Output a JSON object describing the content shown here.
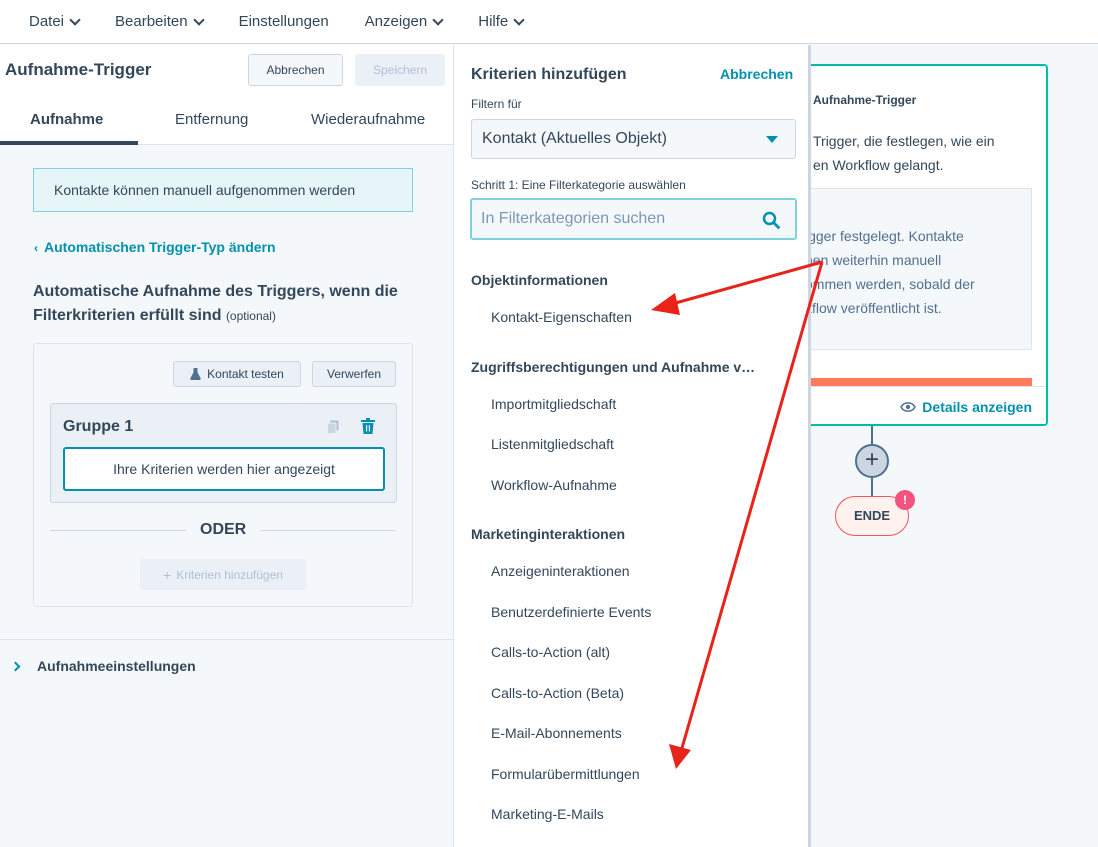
{
  "menu": [
    "Datei",
    "Bearbeiten",
    "Einstellungen",
    "Anzeigen",
    "Hilfe"
  ],
  "left_panel": {
    "title": "Aufnahme-Trigger",
    "cancel_label": "Abbrechen",
    "save_label": "Speichern",
    "tabs": [
      "Aufnahme",
      "Entfernung",
      "Wiederaufnahme"
    ],
    "active_tab": "Aufnahme",
    "info_text": "Kontakte können manuell aufgenommen werden",
    "change_link": "Automatischen Trigger-Typ ändern",
    "section_title": "Automatische Aufnahme des Triggers, wenn die Filterkriterien erfüllt sind",
    "section_optional": "(optional)",
    "test_contact_label": "Kontakt testen",
    "discard_label": "Verwerfen",
    "group_title": "Gruppe 1",
    "criteria_placeholder": "Ihre Kriterien werden hier angezeigt",
    "or_label": "ODER",
    "add_criteria_label": "Kriterien hinzufügen",
    "settings_label": "Aufnahmeeinstellungen"
  },
  "criteria_panel": {
    "title": "Kriterien hinzufügen",
    "cancel_label": "Abbrechen",
    "filter_for_label": "Filtern für",
    "filter_for_value": "Kontakt (Aktuelles Objekt)",
    "step_label": "Schritt 1: Eine Filterkategorie auswählen",
    "search_placeholder": "In Filterkategorien suchen",
    "categories": [
      {
        "header": "Objektinformationen",
        "items": [
          "Kontakt-Eigenschaften"
        ]
      },
      {
        "header": "Zugriffsberechtigungen und Aufnahme v…",
        "items": [
          "Importmitgliedschaft",
          "Listenmitgliedschaft",
          "Workflow-Aufnahme"
        ]
      },
      {
        "header": "Marketinginteraktionen",
        "items": [
          "Anzeigeninteraktionen",
          "Benutzerdefinierte Events",
          "Calls-to-Action (alt)",
          "Calls-to-Action (Beta)",
          "E-Mail-Abonnements",
          "Formularübermittlungen",
          "Marketing-E-Mails"
        ]
      }
    ]
  },
  "canvas": {
    "card_title": "Aufnahme-Trigger",
    "card_desc": "Trigger, die festlegen, wie ein\nen Workflow gelangt.",
    "card_inner": "igger festgelegt. Kontakte\nnen weiterhin manuell\nommen werden, sobald der\nkflow veröffentlicht ist.",
    "details_label": "Details anzeigen",
    "plus_label": "+",
    "end_label": "ENDE",
    "end_badge": "!"
  },
  "colors": {
    "accent": "#0091ae",
    "annotation_arrow": "#e8231a",
    "card_border": "#00bda5",
    "end_badge": "#f2547d"
  }
}
